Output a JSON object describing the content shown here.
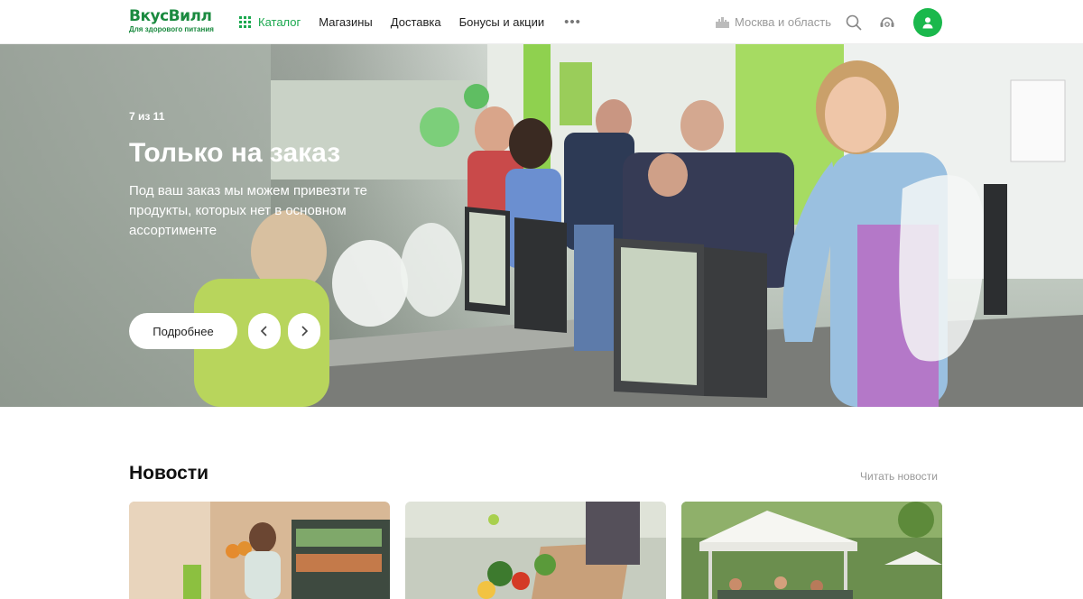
{
  "header": {
    "logo": {
      "name": "ВкусВилл",
      "tagline": "Для здорового питания"
    },
    "nav": [
      {
        "label": "Каталог",
        "icon": "grid-icon",
        "active": true
      },
      {
        "label": "Магазины"
      },
      {
        "label": "Доставка"
      },
      {
        "label": "Бонусы и акции"
      }
    ],
    "more_icon": "more-dots-icon",
    "region": "Москва и область",
    "icons": [
      "search-icon",
      "support-icon",
      "user-icon"
    ]
  },
  "hero": {
    "counter": "7 из 11",
    "title": "Только на заказ",
    "description": "Под ваш заказ мы можем привезти те продукты, которых нет в основном ассортименте",
    "button_label": "Подробнее",
    "prev_icon": "chevron-left-icon",
    "next_icon": "chevron-right-icon"
  },
  "news": {
    "title": "Новости",
    "read_link": "Читать новости"
  },
  "colors": {
    "brand": "#1a8a3f",
    "accent": "#1aa84e",
    "avatar": "#1ab84c"
  }
}
